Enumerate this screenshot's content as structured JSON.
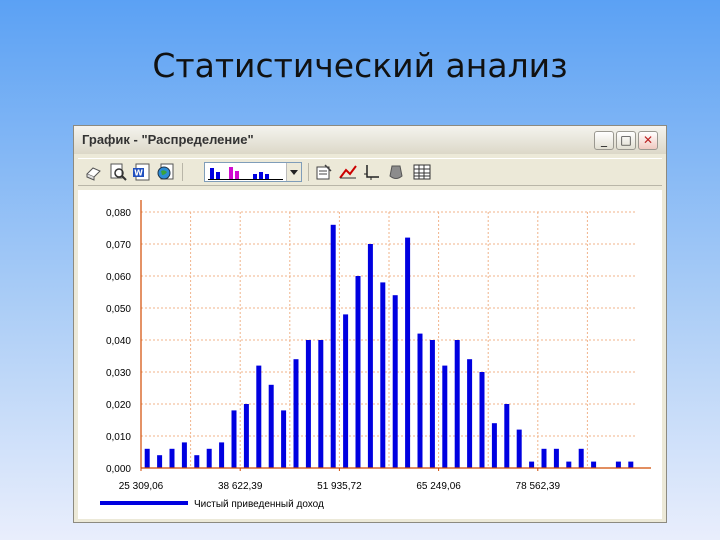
{
  "slide": {
    "title": "Статистический анализ"
  },
  "window": {
    "title": "График - \"Распределение\"",
    "buttons": {
      "minimize": "_",
      "maximize": "□",
      "close": "✕"
    }
  },
  "toolbar": {
    "icons": [
      "print-preview-icon",
      "zoom-icon",
      "word-export-icon",
      "globe-export-icon",
      "properties-icon",
      "line-style-icon",
      "axes-icon",
      "fill-icon",
      "table-icon"
    ],
    "chart_type_selected": "bar"
  },
  "colors": {
    "bar": "#0000e0",
    "grid": "#f0b38a",
    "axis": "#d14a00"
  },
  "chart_data": {
    "type": "bar",
    "ylim": [
      0,
      0.08
    ],
    "ytick_labels": [
      "0,000",
      "0,010",
      "0,020",
      "0,030",
      "0,040",
      "0,050",
      "0,060",
      "0,070",
      "0,080"
    ],
    "xtick_labels": [
      "25 309,06",
      "38 622,39",
      "51 935,72",
      "65 249,06",
      "78 562,39"
    ],
    "grid": true,
    "legend_position": "bottom-left",
    "series": [
      {
        "name": "Чистый приведенный доход",
        "values": [
          0.006,
          0.004,
          0.006,
          0.008,
          0.004,
          0.006,
          0.008,
          0.018,
          0.02,
          0.032,
          0.026,
          0.018,
          0.034,
          0.04,
          0.04,
          0.076,
          0.048,
          0.06,
          0.07,
          0.058,
          0.054,
          0.072,
          0.042,
          0.04,
          0.032,
          0.04,
          0.034,
          0.03,
          0.014,
          0.02,
          0.012,
          0.002,
          0.006,
          0.006,
          0.002,
          0.006,
          0.002,
          0.0,
          0.002,
          0.002
        ]
      }
    ]
  }
}
